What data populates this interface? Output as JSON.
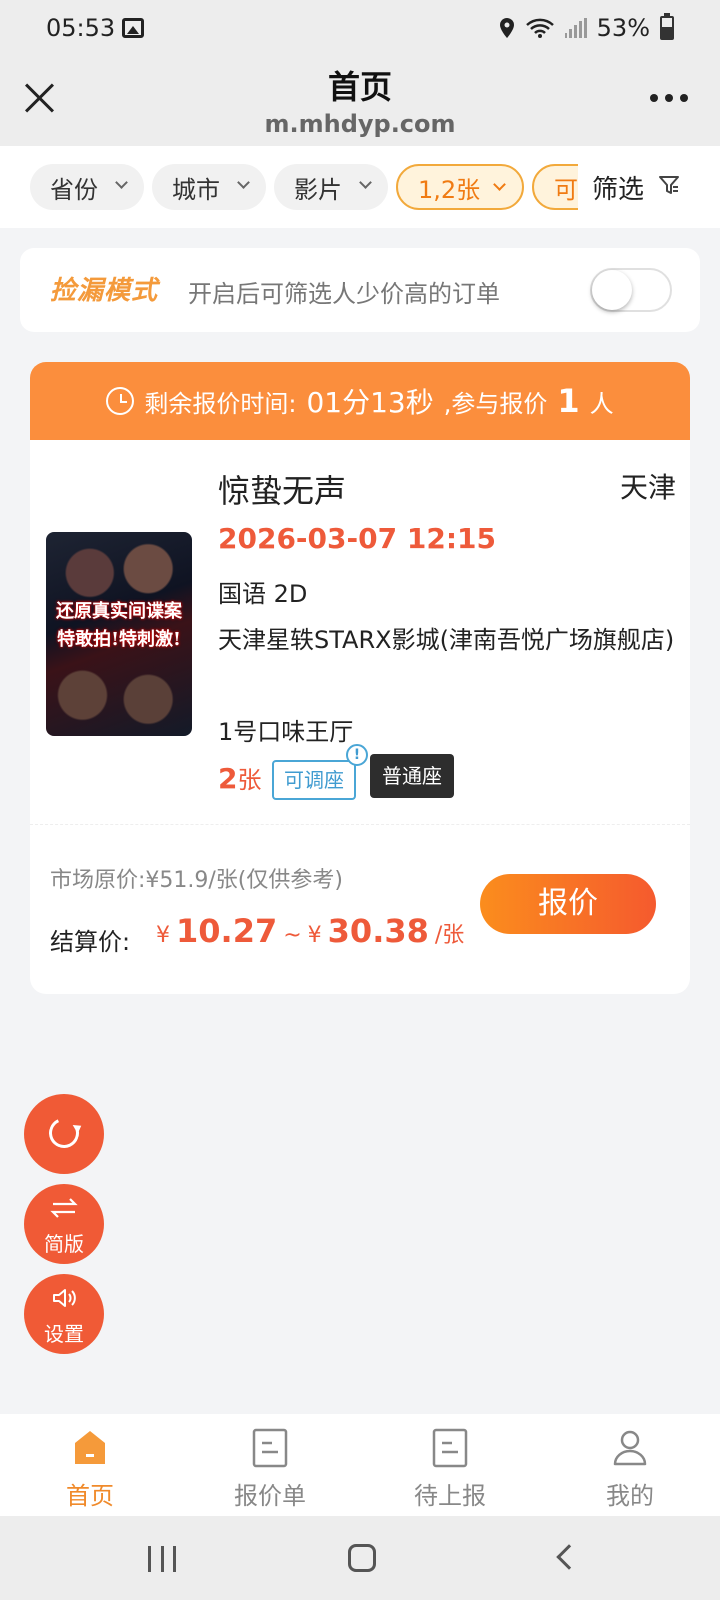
{
  "status_bar": {
    "time": "05:53",
    "battery": "53%"
  },
  "header": {
    "title": "首页",
    "url": "m.mhdyp.com"
  },
  "filters": {
    "chips": [
      {
        "label": "省份"
      },
      {
        "label": "城市"
      },
      {
        "label": "影片"
      },
      {
        "label": "1,2张"
      },
      {
        "label": "可"
      }
    ],
    "filter_label": "筛选"
  },
  "leak_mode": {
    "title": "捡漏模式",
    "description": "开启后可筛选人少价高的订单",
    "enabled": false
  },
  "order": {
    "timer_label": "剩余报价时间:",
    "timer_value": "01分13秒",
    "participants_prefix": ",参与报价",
    "participants_count": "1",
    "participants_suffix": "人",
    "movie": "惊蛰无声",
    "city": "天津",
    "poster_text": "还原真实间谍案 特敢拍!特刺激!",
    "showtime": "2026-03-07 12:15",
    "language": "国语 2D",
    "cinema": "天津星轶STARX影城(津南吾悦广场旗舰店)",
    "hall": "1号口味王厅",
    "quantity": "2",
    "quantity_unit": "张",
    "tag_adjustable": "可调座",
    "tag_info": "!",
    "tag_seat": "普通座",
    "market_price": "市场原价:¥51.9/张(仅供参考)",
    "settle_label": "结算价:",
    "price_currency": "¥",
    "price_min": "10.27",
    "price_sep": "~",
    "price_max": "30.38",
    "price_unit": "/张",
    "quote_button": "报价"
  },
  "floating": {
    "simple_label": "简版",
    "settings_label": "设置"
  },
  "bottom_nav": [
    {
      "label": "首页",
      "active": true
    },
    {
      "label": "报价单",
      "active": false
    },
    {
      "label": "待上报",
      "active": false
    },
    {
      "label": "我的",
      "active": false
    }
  ],
  "colors": {
    "accent_orange": "#fb8e3d",
    "price_red": "#ee5a3a",
    "fab_red": "#f05a36",
    "nav_active": "#f08a2a"
  }
}
